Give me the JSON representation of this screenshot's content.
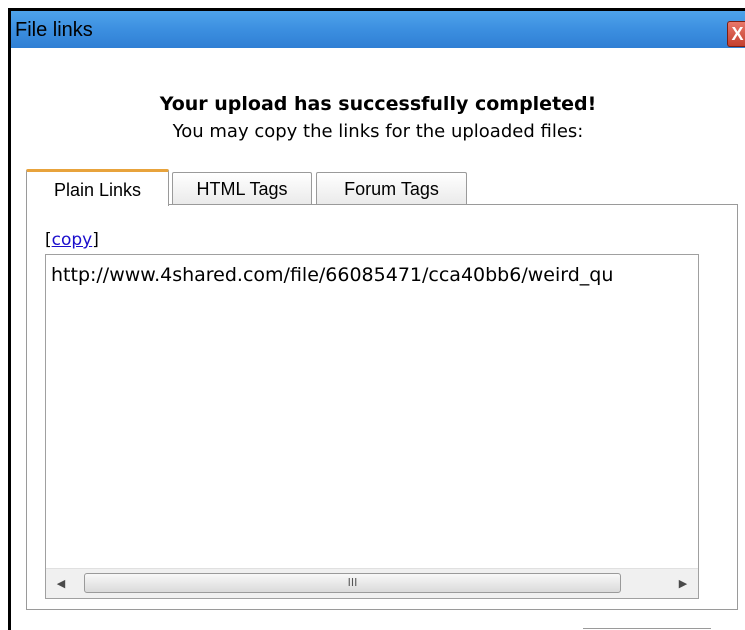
{
  "window": {
    "title": "File links",
    "close_icon": "close-icon",
    "close_glyph": "X"
  },
  "message": {
    "heading": "Your upload has successfully completed!",
    "subheading": "You may copy the links for the uploaded files:"
  },
  "tabs": [
    {
      "label": "Plain Links",
      "active": true
    },
    {
      "label": "HTML Tags",
      "active": false
    },
    {
      "label": "Forum Tags",
      "active": false
    }
  ],
  "links_panel": {
    "copy_open": "[",
    "copy_label": "copy",
    "copy_close": "]",
    "textarea_value": "http://www.4shared.com/file/66085471/cca40bb6/weird_qu",
    "scroll_left_glyph": "◀",
    "scroll_right_glyph": "▶",
    "scroll_thumb_grip": "III"
  },
  "colors": {
    "titlebar": "#3c8fe0",
    "active_tab_accent": "#e8a33c",
    "link": "#1a0dcc",
    "close_button": "#c4402f"
  }
}
